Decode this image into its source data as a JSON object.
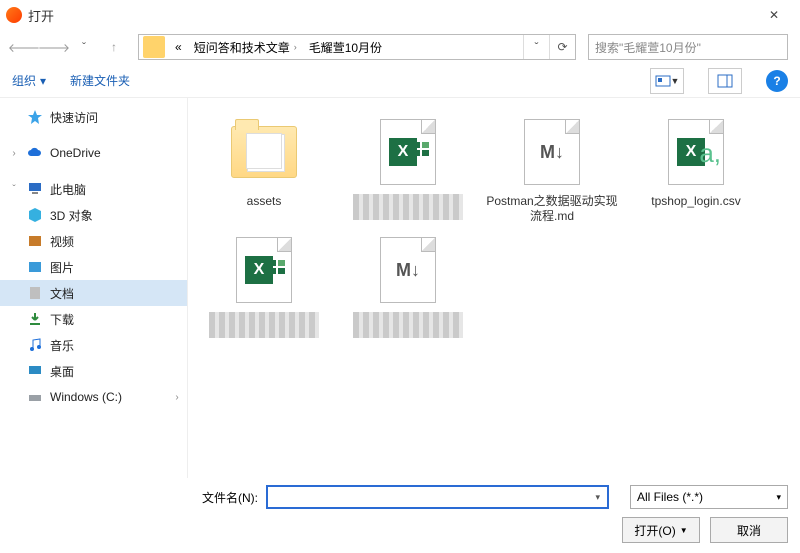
{
  "title": "打开",
  "breadcrumb": {
    "prefix": "«",
    "seg1": "短问答和技术文章",
    "seg2": "毛耀萱10月份"
  },
  "search_placeholder": "搜索\"毛耀萱10月份\"",
  "toolbar": {
    "organize": "组织",
    "newfolder": "新建文件夹",
    "help": "?"
  },
  "sidebar": {
    "quick": "快速访问",
    "onedrive": "OneDrive",
    "thispc": "此电脑",
    "items": [
      {
        "label": "3D 对象"
      },
      {
        "label": "视频"
      },
      {
        "label": "图片"
      },
      {
        "label": "文档"
      },
      {
        "label": "下载"
      },
      {
        "label": "音乐"
      },
      {
        "label": "桌面"
      },
      {
        "label": "Windows (C:)"
      }
    ]
  },
  "files": {
    "r1": [
      {
        "name": "assets"
      },
      {
        "name": ""
      },
      {
        "name": "Postman之数据驱动实现流程.md"
      },
      {
        "name": "tpshop_login.csv"
      }
    ]
  },
  "filename_label": "文件名(N):",
  "filter_label": "All Files (*.*)",
  "open_btn": "打开(O)",
  "cancel_btn": "取消",
  "glyph": {
    "chev_right": "›",
    "chev_left": "‹",
    "up": "↑",
    "down": "ˇ",
    "tri_down": "▾",
    "reload": "⟳",
    "close": "✕"
  }
}
